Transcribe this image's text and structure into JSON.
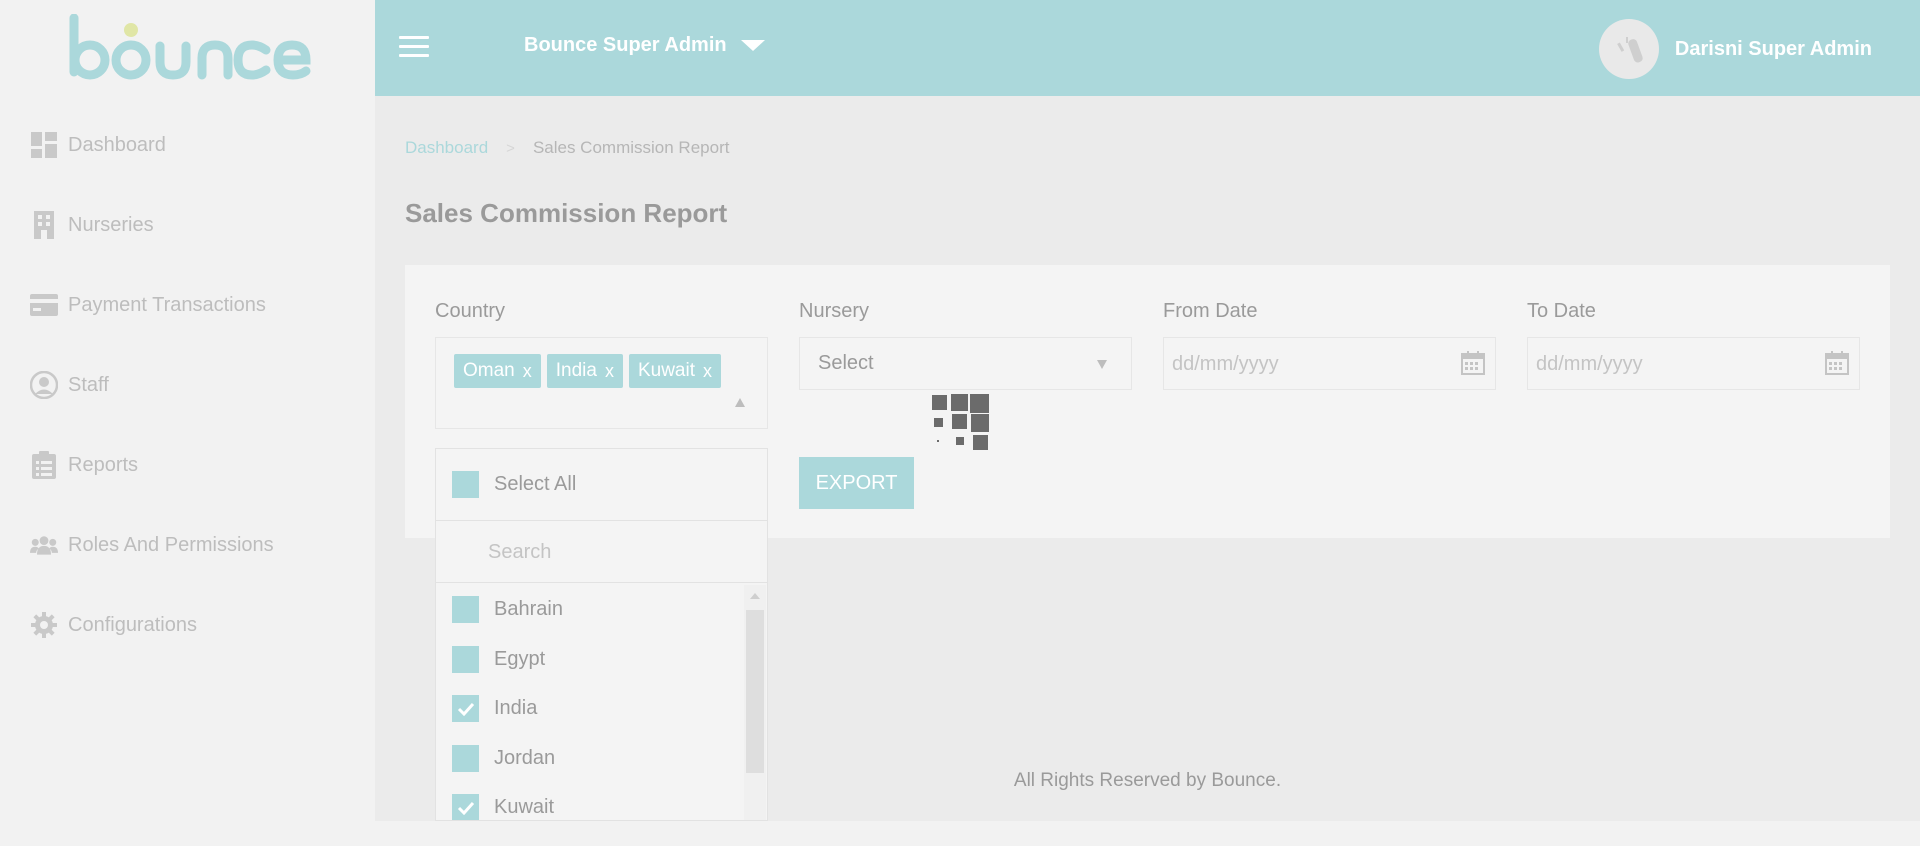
{
  "brand": {
    "logo_text": "bounce",
    "accent_color": "#abd8db"
  },
  "sidebar": {
    "items": [
      {
        "label": "Dashboard",
        "icon": "dashboard-icon"
      },
      {
        "label": "Nurseries",
        "icon": "building-icon"
      },
      {
        "label": "Payment Transactions",
        "icon": "credit-card-icon"
      },
      {
        "label": "Staff",
        "icon": "user-circle-icon"
      },
      {
        "label": "Reports",
        "icon": "clipboard-icon"
      },
      {
        "label": "Roles And Permissions",
        "icon": "users-group-icon"
      },
      {
        "label": "Configurations",
        "icon": "gear-icon"
      }
    ]
  },
  "header": {
    "admin_switch": "Bounce Super Admin",
    "user_name": "Darisni Super Admin"
  },
  "breadcrumb": {
    "root": "Dashboard",
    "separator": ">",
    "current": "Sales Commission Report"
  },
  "page_title": "Sales Commission Report",
  "filters": {
    "country": {
      "label": "Country",
      "chips": [
        {
          "label": "Oman",
          "remove": "x"
        },
        {
          "label": "India",
          "remove": "x"
        },
        {
          "label": "Kuwait",
          "remove": "x"
        }
      ]
    },
    "nursery": {
      "label": "Nursery",
      "value": "Select"
    },
    "from_date": {
      "label": "From Date",
      "placeholder": "dd/mm/yyyy"
    },
    "to_date": {
      "label": "To Date",
      "placeholder": "dd/mm/yyyy"
    }
  },
  "export_label": "EXPORT",
  "dropdown": {
    "select_all": "Select All",
    "search_placeholder": "Search",
    "options": [
      {
        "label": "Bahrain",
        "checked": false
      },
      {
        "label": "Egypt",
        "checked": false
      },
      {
        "label": "India",
        "checked": true
      },
      {
        "label": "Jordan",
        "checked": false
      },
      {
        "label": "Kuwait",
        "checked": true
      }
    ]
  },
  "footer": "All Rights Reserved by Bounce."
}
